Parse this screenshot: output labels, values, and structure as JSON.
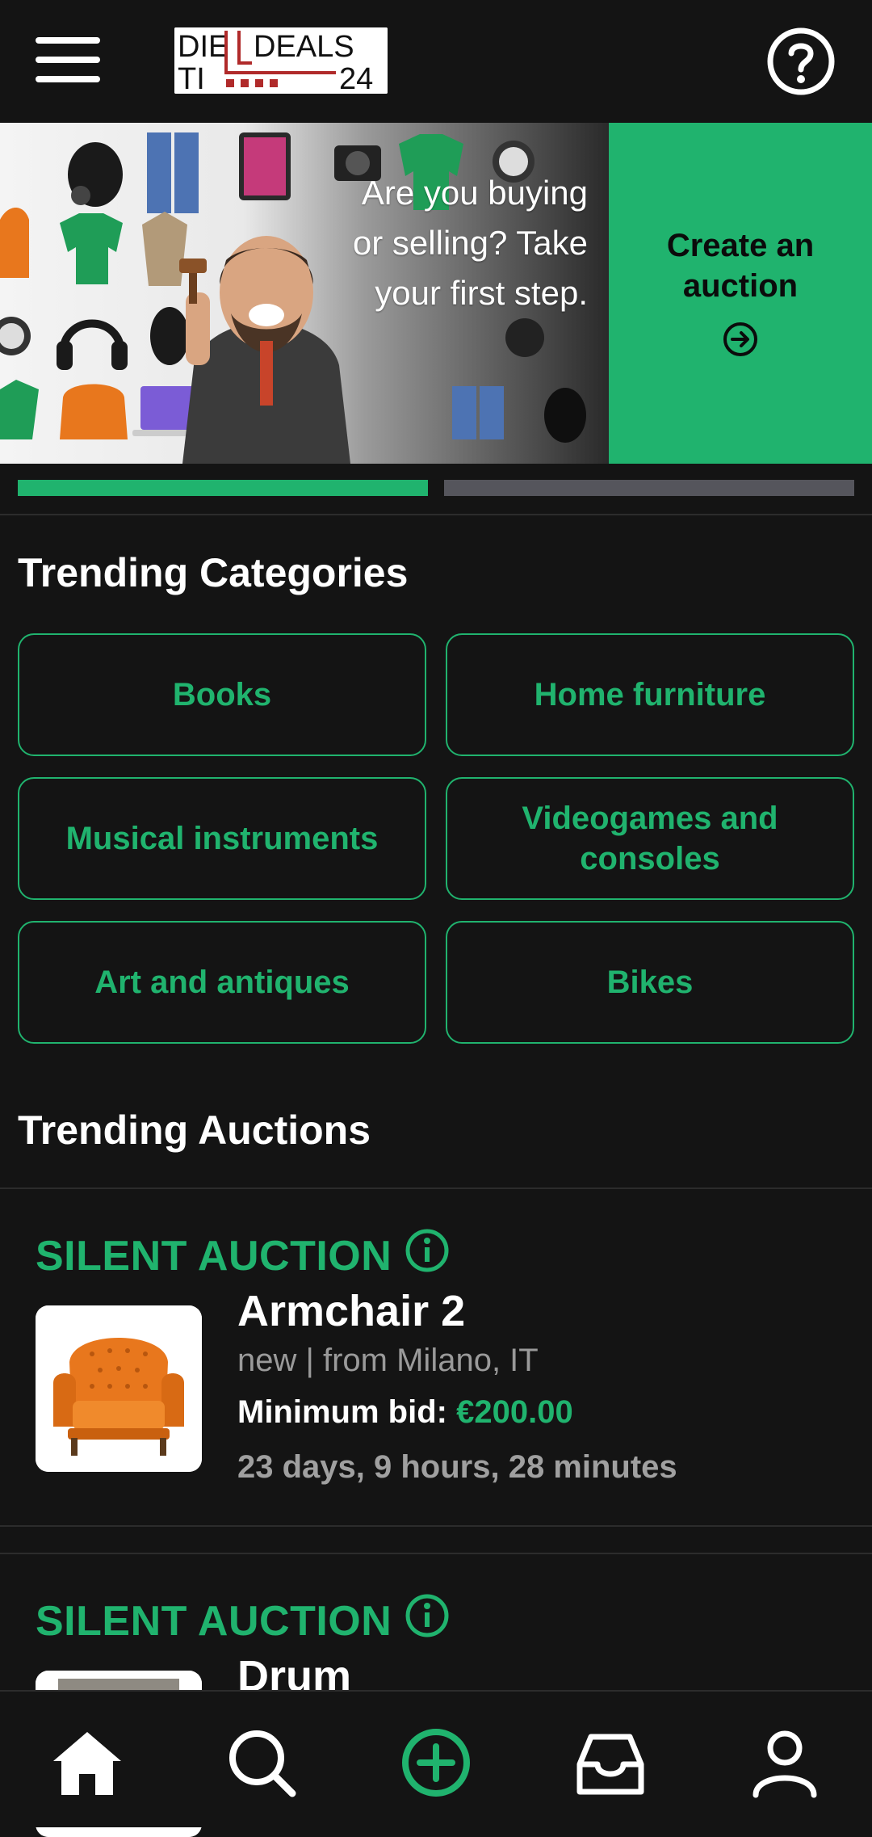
{
  "header": {
    "logo_text_left_top": "DIE",
    "logo_text_right_top": "DEALS",
    "logo_text_left_bottom": "TI",
    "logo_text_right_bottom": "24",
    "menu_icon": "hamburger-menu-icon",
    "help_icon": "help-circle-icon"
  },
  "banner": {
    "text": "Are you buying or selling? Take your first step.",
    "cta_label": "Create an auction",
    "cta_icon": "arrow-right-circle-icon"
  },
  "carousel": {
    "active_index": 0,
    "count": 2
  },
  "trending_categories": {
    "title": "Trending Categories",
    "items": [
      {
        "label": "Books"
      },
      {
        "label": "Home furniture"
      },
      {
        "label": "Musical instruments"
      },
      {
        "label": "Videogames and consoles"
      },
      {
        "label": "Art and antiques"
      },
      {
        "label": "Bikes"
      }
    ]
  },
  "trending_auctions": {
    "title": "Trending Auctions",
    "items": [
      {
        "type": "SILENT AUCTION",
        "title": "Armchair 2",
        "subtitle": "new | from Milano, IT",
        "bid_label": "Minimum bid:",
        "bid_amount": "€200.00",
        "time_left": "23 days, 9 hours, 28 minutes"
      },
      {
        "type": "SILENT AUCTION",
        "title": "Drum"
      }
    ]
  },
  "bottom_nav": {
    "items": [
      "home-icon",
      "search-icon",
      "add-circle-icon",
      "inbox-icon",
      "profile-icon"
    ]
  },
  "colors": {
    "accent": "#20b36e",
    "background": "#141414",
    "muted": "#9a9a9a"
  }
}
